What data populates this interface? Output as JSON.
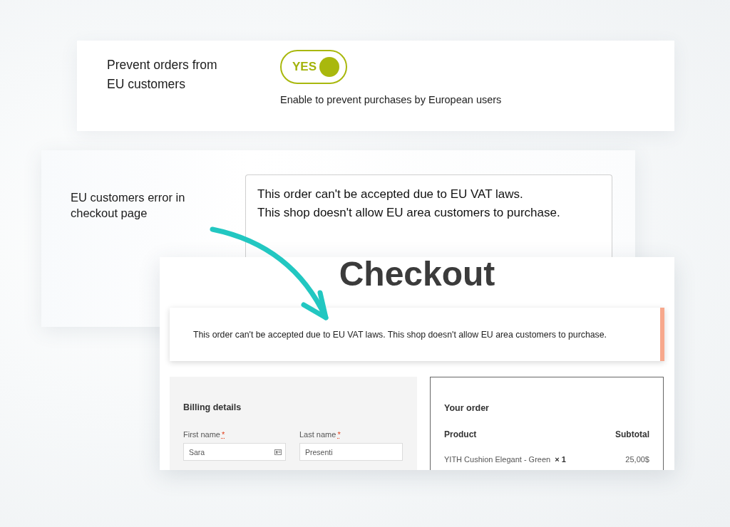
{
  "settings": [
    {
      "kind": "toggle",
      "label": "Prevent orders from EU customers",
      "toggle": {
        "label": "YES",
        "on": true
      },
      "description": "Enable to prevent purchases by European users"
    },
    {
      "kind": "textarea",
      "label": "EU customers error in checkout page",
      "value": "This order can't be accepted due to EU VAT laws.\nThis shop doesn't allow EU area customers to purchase."
    }
  ],
  "checkout": {
    "title": "Checkout",
    "notice": {
      "kind": "error",
      "text": "This order can't be accepted due to EU VAT laws. This shop doesn't allow EU area customers to purchase."
    },
    "billing": {
      "title": "Billing details",
      "fields": [
        {
          "label": "First name",
          "required_mark": "*",
          "value": "Sara",
          "autofill_icon": true
        },
        {
          "label": "Last name",
          "required_mark": "*",
          "value": "Presenti",
          "autofill_icon": false
        }
      ]
    },
    "order": {
      "title": "Your order",
      "columns": [
        "Product",
        "Subtotal"
      ],
      "items": [
        {
          "name": "YITH Cushion Elegant - Green",
          "quantity": "× 1",
          "subtotal": "25,00$"
        }
      ]
    }
  }
}
